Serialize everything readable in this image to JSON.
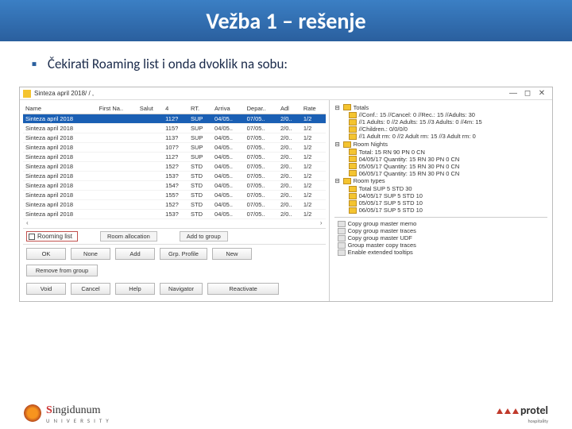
{
  "slide": {
    "title": "Vežba 1 – rešenje",
    "bullet": "Čekirati Roaming list i onda dvoklik na sobu:"
  },
  "window": {
    "title": "Sinteza april 2018/ /  ,"
  },
  "table": {
    "headers": [
      "Name",
      "First Na..",
      "Salut",
      "4",
      "RT.",
      "Arriva",
      "Depar..",
      "Adl",
      "Rate"
    ],
    "rows": [
      [
        "Sinteza april 2018",
        "",
        "",
        "112?",
        "SUP",
        "04/05..",
        "07/05..",
        "2/0..",
        "1/2"
      ],
      [
        "Sinteza april 2018",
        "",
        "",
        "115?",
        "SUP",
        "04/05..",
        "07/05..",
        "2/0..",
        "1/2"
      ],
      [
        "Sinteza april 2018",
        "",
        "",
        "113?",
        "SUP",
        "04/05..",
        "07/05..",
        "2/0..",
        "1/2"
      ],
      [
        "Sinteza april 2018",
        "",
        "",
        "107?",
        "SUP",
        "04/05..",
        "07/05..",
        "2/0..",
        "1/2"
      ],
      [
        "Sinteza april 2018",
        "",
        "",
        "112?",
        "SUP",
        "04/05..",
        "07/05..",
        "2/0..",
        "1/2"
      ],
      [
        "Sinteza april 2018",
        "",
        "",
        "152?",
        "STD",
        "04/05..",
        "07/05..",
        "2/0..",
        "1/2"
      ],
      [
        "Sinteza april 2018",
        "",
        "",
        "153?",
        "STD",
        "04/05..",
        "07/05..",
        "2/0..",
        "1/2"
      ],
      [
        "Sinteza april 2018",
        "",
        "",
        "154?",
        "STD",
        "04/05..",
        "07/05..",
        "2/0..",
        "1/2"
      ],
      [
        "Sinteza april 2018",
        "",
        "",
        "155?",
        "STD",
        "04/05..",
        "07/05..",
        "2/0..",
        "1/2"
      ],
      [
        "Sinteza april 2018",
        "",
        "",
        "152?",
        "STD",
        "04/05..",
        "07/05..",
        "2/0..",
        "1/2"
      ],
      [
        "Sinteza april 2018",
        "",
        "",
        "153?",
        "STD",
        "04/05..",
        "07/05..",
        "2/0..",
        "1/2"
      ]
    ]
  },
  "roomlist_label": "Rooming list",
  "midbuttons": {
    "alloc": "Room allocation",
    "addg": "Add to group"
  },
  "buttons": {
    "ok": "OK",
    "none": "None",
    "add": "Add",
    "grpprof": "Grp. Profile",
    "new": "New",
    "remove": "Remove from group",
    "void": "Void",
    "cancel": "Cancel",
    "help": "Help",
    "navigator": "Navigator",
    "deact": "Reactivate"
  },
  "tree": {
    "totals": "Totals",
    "totals_items": [
      "//Conf.: 15 //Cancel: 0 //Rec.: 15 //Adults: 30",
      "//1 Adults: 0 //2 Adults: 15 //3 Adults: 0 //4m: 15",
      "//Children.: 0/0/0/0",
      "//1 Adult rm: 0 //2 Adult rm: 15 //3 Adult rm: 0"
    ],
    "nights": "Room Nights",
    "nights_items": [
      "Total: 15 RN 90 PN 0 CN",
      "04/05/17 Quantity: 15 RN 30 PN 0 CN",
      "05/05/17 Quantity: 15 RN 30 PN 0 CN",
      "06/05/17 Quantity: 15 RN 30 PN 0 CN"
    ],
    "types": "Room types",
    "types_items": [
      "Total SUP 5 STD 30",
      "04/05/17 SUP 5 STD 10",
      "05/05/17 SUP 5 STD 10",
      "06/05/17 SUP 5 STD 10"
    ],
    "actions": [
      "Copy group master memo",
      "Copy group master traces",
      "Copy group master UDF",
      "Group master copy traces",
      "Enable extended tooltips"
    ]
  },
  "logos": {
    "singi1": "S",
    "singi2": "ingidunum",
    "singi_sub": "UNIVERSITY",
    "protel": "protel",
    "protel_sub": "hospitality"
  }
}
